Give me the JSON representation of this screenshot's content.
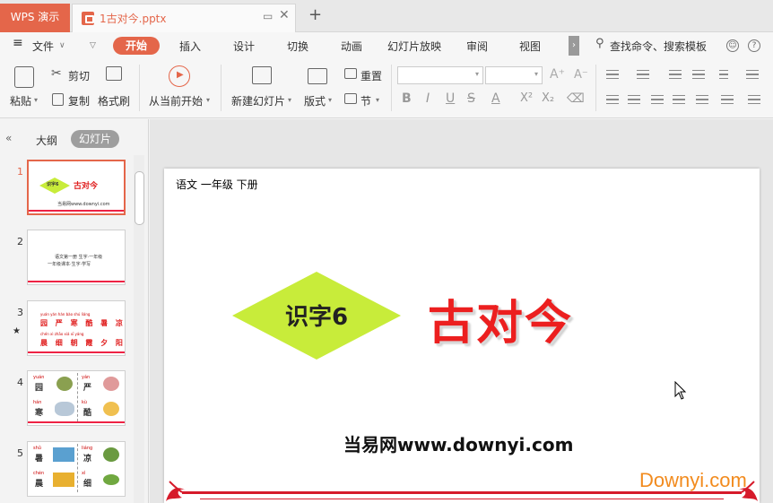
{
  "titlebar": {
    "app_tab": "WPS 演示",
    "doc_tab": "1古对今.pptx",
    "new_tab": "+"
  },
  "menubar": {
    "file": "文件",
    "tabs": [
      "开始",
      "插入",
      "设计",
      "切换",
      "动画",
      "幻灯片放映",
      "审阅",
      "视图"
    ],
    "search": "查找命令、搜索模板"
  },
  "ribbon": {
    "paste": "粘贴",
    "cut": "剪切",
    "copy": "复制",
    "format_painter": "格式刷",
    "from_current": "从当前开始",
    "new_slide": "新建幻灯片",
    "layout": "版式",
    "reset": "重置",
    "section": "节"
  },
  "leftpane": {
    "tab_outline": "大纲",
    "tab_slides": "幻灯片",
    "thumbs": [
      {
        "num": "1",
        "badge": "识字6",
        "title": "古对今",
        "site": "当易网www.downyi.com"
      },
      {
        "num": "2",
        "line1": "语文第一册 生字·一年级",
        "line2": "一年级课本·生字·学写"
      },
      {
        "num": "3",
        "pinyin1": "yuán  yán  hán  bào  shú  liáng",
        "chars1": "园 严 寒 酷 暑 凉",
        "pinyin2": "chén  xì  zhāo  xiá  xī  yáng",
        "chars2": "晨 细 朝 霞 夕 阳"
      },
      {
        "num": "4",
        "a_py": "yuán",
        "a_ch": "园",
        "b_py": "yán",
        "b_ch": "严",
        "c_py": "hán",
        "c_ch": "寒",
        "d_py": "kù",
        "d_ch": "酷"
      },
      {
        "num": "5",
        "a_py": "shǔ",
        "a_ch": "暑",
        "b_py": "liáng",
        "b_ch": "凉",
        "c_py": "chén",
        "c_ch": "晨",
        "d_py": "xì",
        "d_ch": "细"
      }
    ]
  },
  "slide": {
    "course": "语文    一年级    下册",
    "badge": "识字6",
    "title": "古对今",
    "site": "当易网www.downyi.com"
  },
  "watermark": "Downyi.com",
  "colors": {
    "accent": "#e4664a",
    "title_red": "#ec1f1f",
    "diamond": "#c8ec3a",
    "deco_red": "#d61a2a"
  }
}
